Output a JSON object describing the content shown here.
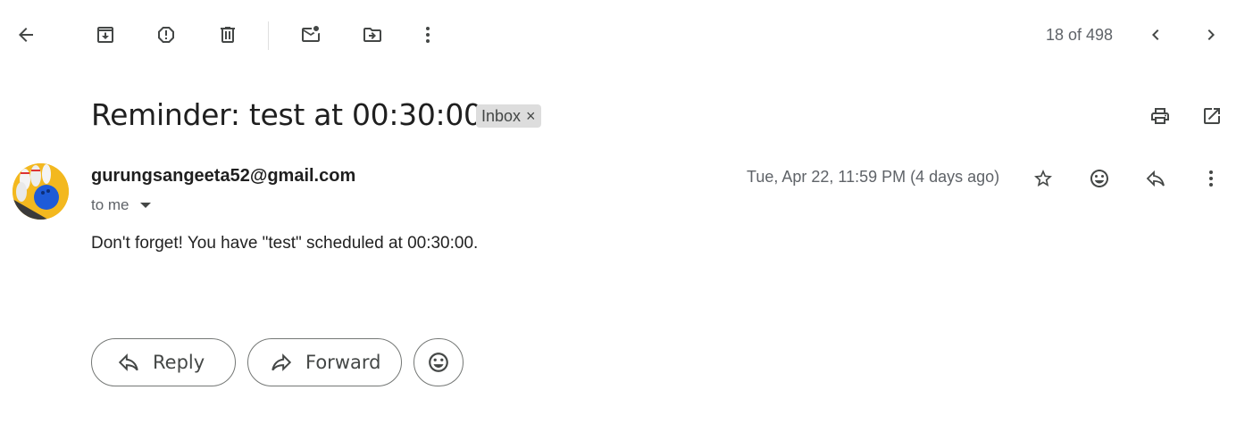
{
  "toolbar": {
    "counter": "18 of 498",
    "icons": [
      "back-arrow-icon",
      "archive-icon",
      "report-spam-icon",
      "delete-icon",
      "mark-unread-icon",
      "move-to-icon",
      "more-vert-icon",
      "chevron-left-icon",
      "chevron-right-icon"
    ]
  },
  "message": {
    "subject": "Reminder: test at 00:30:00",
    "label": "Inbox",
    "label_remove": "×",
    "sender": "gurungsangeeta52@gmail.com",
    "recipient_text": "to me",
    "date": "Tue, Apr 22, 11:59 PM (4 days ago)",
    "body": "Don't forget! You have \"test\" scheduled at 00:30:00."
  },
  "actions": {
    "reply_label": "Reply",
    "forward_label": "Forward"
  },
  "colors": {
    "icon": "#444746",
    "muted_text": "#5f6368",
    "chip_bg": "#dddddd",
    "avatar_bg": "#f3b81f"
  }
}
